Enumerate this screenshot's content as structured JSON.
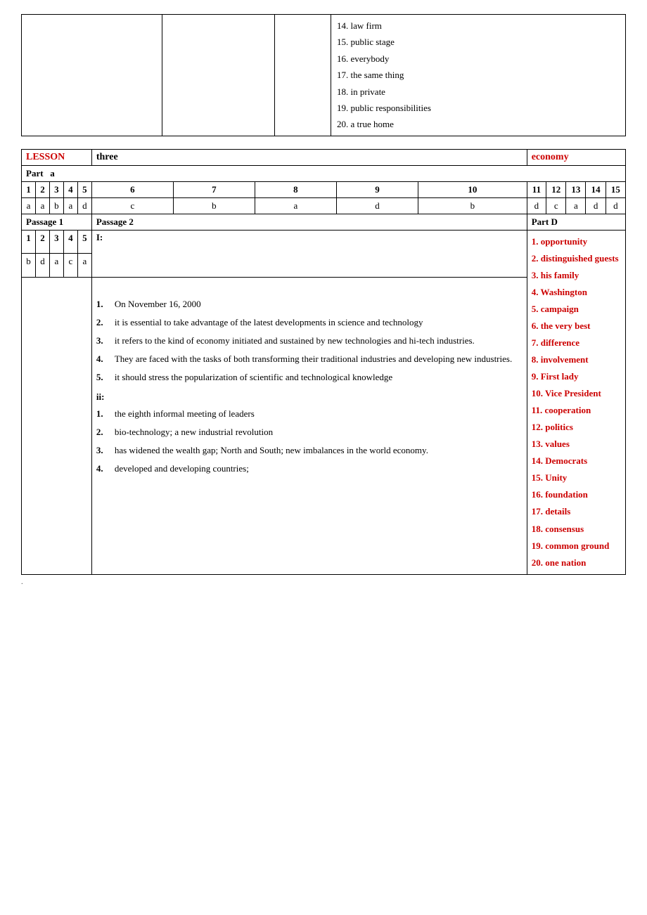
{
  "top_section": {
    "vocab_items": [
      "14.  law firm",
      "15.  public stage",
      "16.  everybody",
      "17.  the same thing",
      "18.  in private",
      "19.  public responsibilities",
      "20.  a true home"
    ]
  },
  "lesson": {
    "label": "LESSON",
    "three": "three",
    "economy": "economy"
  },
  "part_a": {
    "label": "Part",
    "sub": "a",
    "numbers": [
      "1",
      "2",
      "3",
      "4",
      "5",
      "6",
      "7",
      "8",
      "9",
      "10",
      "11",
      "12",
      "13",
      "14",
      "15"
    ],
    "answers": [
      "a",
      "a",
      "b",
      "a",
      "d",
      "c",
      "b",
      "a",
      "d",
      "b",
      "d",
      "c",
      "a",
      "d",
      "d"
    ]
  },
  "passage1": {
    "label": "Passage 1",
    "numbers": [
      "1",
      "2",
      "3",
      "4",
      "5"
    ],
    "answers": [
      "b",
      "d",
      "a",
      "c",
      "a"
    ]
  },
  "passage2": {
    "label": "Passage 2",
    "items_i": [
      {
        "num": "1.",
        "text": "On November 16, 2000"
      },
      {
        "num": "2.",
        "text": "it is essential to take advantage of the latest developments in science and technology"
      },
      {
        "num": "3.",
        "text": "it refers to the kind of economy initiated and sustained by new technologies and hi-tech industries."
      },
      {
        "num": "4.",
        "text": "They are faced with the tasks of both transforming their traditional industries and developing new industries."
      },
      {
        "num": "5.",
        "text": "it should stress the popularization of scientific and technological knowledge"
      }
    ],
    "items_ii": [
      {
        "num": "1.",
        "text": "the eighth informal meeting of leaders"
      },
      {
        "num": "2.",
        "text": "bio-technology; a new industrial revolution"
      },
      {
        "num": "3.",
        "text": "has widened the wealth gap; North and South; new imbalances in the world economy."
      },
      {
        "num": "4.",
        "text": "developed and developing countries;"
      }
    ]
  },
  "part_d": {
    "label": "Part D",
    "items": [
      "1.   opportunity",
      "2.   distinguished guests",
      "3.   his family",
      "4.   Washington",
      "5.   campaign",
      "6.   the very best",
      "7.   difference",
      "8.   involvement",
      "9.   First  lady",
      "10.  Vice President",
      "11.  cooperation",
      "12.  politics",
      "13.  values",
      "14.  Democrats",
      "15.  Unity",
      "16.  foundation",
      "17.  details",
      "18.  consensus",
      "19.  common ground",
      "20.  one nation"
    ]
  }
}
